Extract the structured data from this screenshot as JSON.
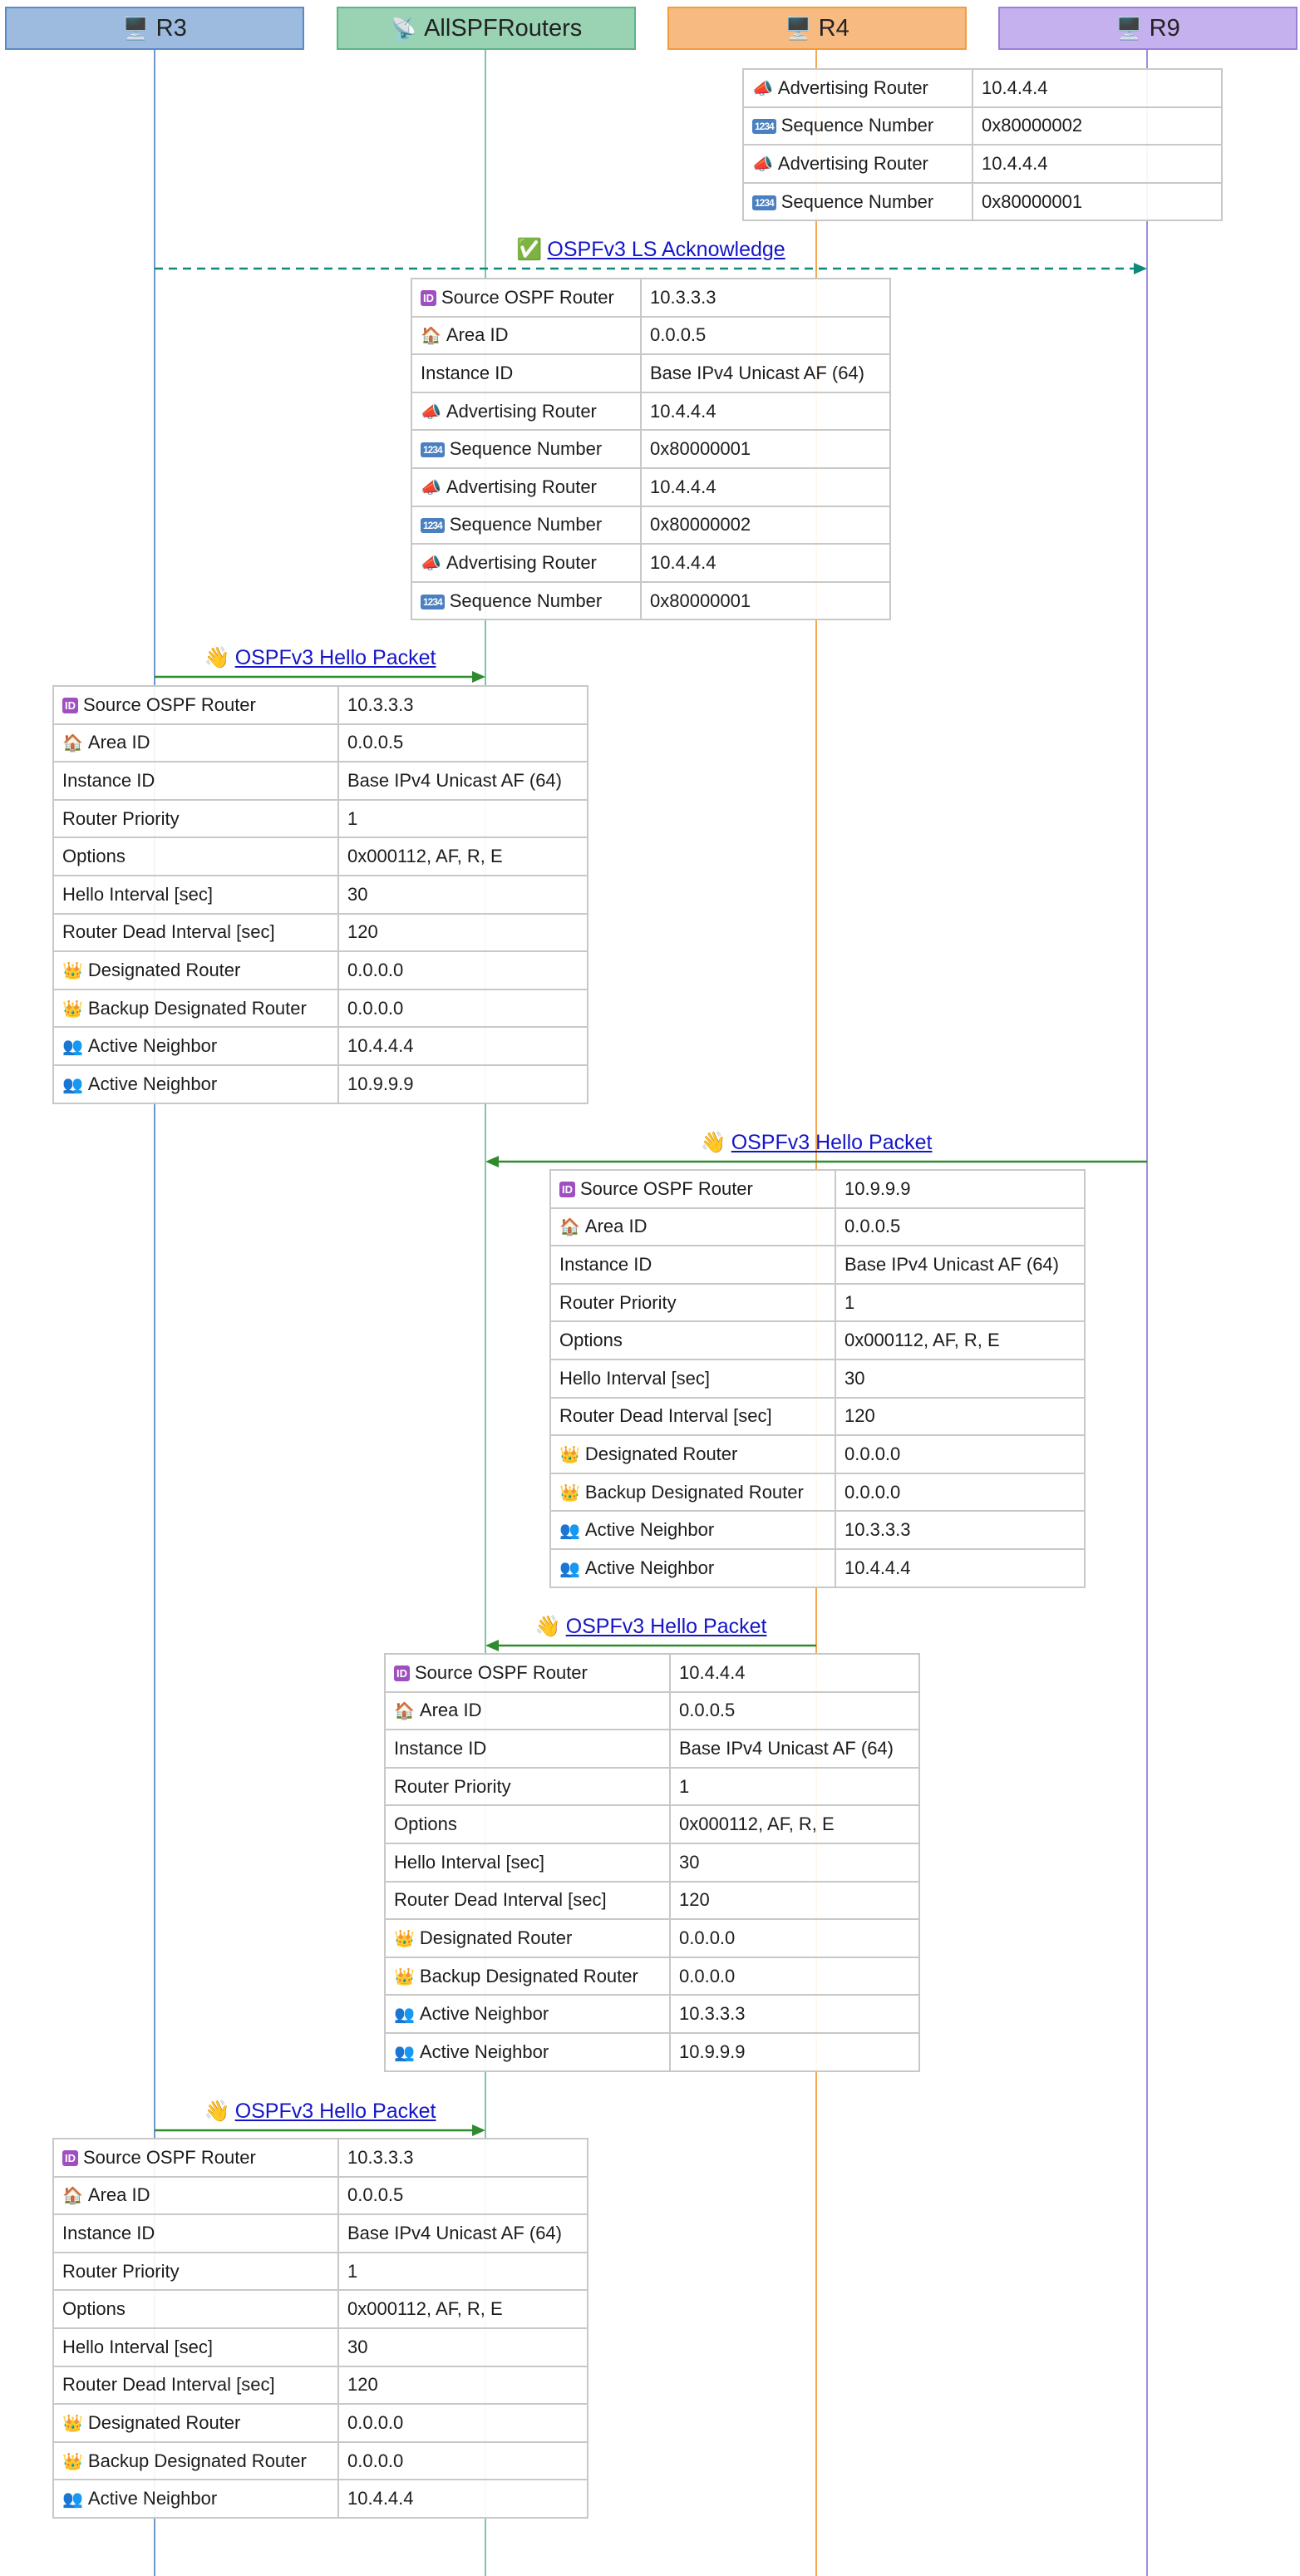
{
  "participants": [
    {
      "id": "R3",
      "label": "R3",
      "icon": "🖥️",
      "icon_name": "computer-icon",
      "fill": "#9dbbdf",
      "stroke": "#5b8ac4",
      "line": "#6d99c9"
    },
    {
      "id": "AllSPFRouters",
      "label": "AllSPFRouters",
      "icon": "📡",
      "icon_name": "satellite-antenna-icon",
      "fill": "#99d3b4",
      "stroke": "#5fb386",
      "line": "#7fc4a8"
    },
    {
      "id": "R4",
      "label": "R4",
      "icon": "🖥️",
      "icon_name": "computer-icon",
      "fill": "#f7bb82",
      "stroke": "#f59a3c",
      "line": "#f5a84f"
    },
    {
      "id": "R9",
      "label": "R9",
      "icon": "🖥️",
      "icon_name": "computer-icon",
      "fill": "#c5b1ee",
      "stroke": "#9b80d8",
      "line": "#9e8fdb"
    }
  ],
  "icons": {
    "id": {
      "glyph": "ID",
      "name": "id-badge-icon"
    },
    "home": {
      "glyph": "🏠",
      "name": "house-icon"
    },
    "megaphone": {
      "glyph": "📣",
      "name": "megaphone-icon"
    },
    "numbers": {
      "glyph": "1234",
      "name": "numbers-icon"
    },
    "crown": {
      "glyph": "👑",
      "name": "crown-icon"
    },
    "people": {
      "glyph": "👥",
      "name": "people-icon"
    },
    "wave": {
      "glyph": "👋",
      "name": "waving-hand-icon"
    },
    "check": {
      "glyph": "✅",
      "name": "check-mark-icon"
    }
  },
  "blocks": [
    {
      "kind": "table",
      "rows": [
        {
          "icon": "megaphone",
          "label": "Advertising Router",
          "value": "10.4.4.4"
        },
        {
          "icon": "numbers",
          "label": "Sequence Number",
          "value": "0x80000002"
        },
        {
          "icon": "megaphone",
          "label": "Advertising Router",
          "value": "10.4.4.4"
        },
        {
          "icon": "numbers",
          "label": "Sequence Number",
          "value": "0x80000001"
        }
      ]
    },
    {
      "kind": "message",
      "from": "R3",
      "to": "R9",
      "style": "dashed",
      "color": "#0f8a7a",
      "icon": "check",
      "label": "OSPFv3 LS Acknowledge",
      "rows": [
        {
          "icon": "id",
          "label": "Source OSPF Router",
          "value": "10.3.3.3"
        },
        {
          "icon": "home",
          "label": "Area ID",
          "value": "0.0.0.5"
        },
        {
          "icon": "",
          "label": "Instance ID",
          "value": "Base IPv4 Unicast AF (64)"
        },
        {
          "icon": "megaphone",
          "label": "Advertising Router",
          "value": "10.4.4.4"
        },
        {
          "icon": "numbers",
          "label": "Sequence Number",
          "value": "0x80000001"
        },
        {
          "icon": "megaphone",
          "label": "Advertising Router",
          "value": "10.4.4.4"
        },
        {
          "icon": "numbers",
          "label": "Sequence Number",
          "value": "0x80000002"
        },
        {
          "icon": "megaphone",
          "label": "Advertising Router",
          "value": "10.4.4.4"
        },
        {
          "icon": "numbers",
          "label": "Sequence Number",
          "value": "0x80000001"
        }
      ]
    },
    {
      "kind": "message",
      "from": "R3",
      "to": "AllSPFRouters",
      "style": "solid",
      "color": "#2e8b2e",
      "icon": "wave",
      "label": "OSPFv3 Hello Packet",
      "rows": [
        {
          "icon": "id",
          "label": "Source OSPF Router",
          "value": "10.3.3.3"
        },
        {
          "icon": "home",
          "label": "Area ID",
          "value": "0.0.0.5"
        },
        {
          "icon": "",
          "label": "Instance ID",
          "value": "Base IPv4 Unicast AF (64)"
        },
        {
          "icon": "",
          "label": "Router Priority",
          "value": "1"
        },
        {
          "icon": "",
          "label": "Options",
          "value": "0x000112, AF, R, E"
        },
        {
          "icon": "",
          "label": "Hello Interval [sec]",
          "value": "30"
        },
        {
          "icon": "",
          "label": "Router Dead Interval [sec]",
          "value": "120"
        },
        {
          "icon": "crown",
          "label": "Designated Router",
          "value": "0.0.0.0"
        },
        {
          "icon": "crown",
          "label": "Backup Designated Router",
          "value": "0.0.0.0"
        },
        {
          "icon": "people",
          "label": "Active Neighbor",
          "value": "10.4.4.4"
        },
        {
          "icon": "people",
          "label": "Active Neighbor",
          "value": "10.9.9.9"
        }
      ]
    },
    {
      "kind": "message",
      "from": "R9",
      "to": "AllSPFRouters",
      "style": "solid",
      "color": "#2e8b2e",
      "icon": "wave",
      "label": "OSPFv3 Hello Packet",
      "rows": [
        {
          "icon": "id",
          "label": "Source OSPF Router",
          "value": "10.9.9.9"
        },
        {
          "icon": "home",
          "label": "Area ID",
          "value": "0.0.0.5"
        },
        {
          "icon": "",
          "label": "Instance ID",
          "value": "Base IPv4 Unicast AF (64)"
        },
        {
          "icon": "",
          "label": "Router Priority",
          "value": "1"
        },
        {
          "icon": "",
          "label": "Options",
          "value": "0x000112, AF, R, E"
        },
        {
          "icon": "",
          "label": "Hello Interval [sec]",
          "value": "30"
        },
        {
          "icon": "",
          "label": "Router Dead Interval [sec]",
          "value": "120"
        },
        {
          "icon": "crown",
          "label": "Designated Router",
          "value": "0.0.0.0"
        },
        {
          "icon": "crown",
          "label": "Backup Designated Router",
          "value": "0.0.0.0"
        },
        {
          "icon": "people",
          "label": "Active Neighbor",
          "value": "10.3.3.3"
        },
        {
          "icon": "people",
          "label": "Active Neighbor",
          "value": "10.4.4.4"
        }
      ]
    },
    {
      "kind": "message",
      "from": "R4",
      "to": "AllSPFRouters",
      "style": "solid",
      "color": "#2e8b2e",
      "icon": "wave",
      "label": "OSPFv3 Hello Packet",
      "rows": [
        {
          "icon": "id",
          "label": "Source OSPF Router",
          "value": "10.4.4.4"
        },
        {
          "icon": "home",
          "label": "Area ID",
          "value": "0.0.0.5"
        },
        {
          "icon": "",
          "label": "Instance ID",
          "value": "Base IPv4 Unicast AF (64)"
        },
        {
          "icon": "",
          "label": "Router Priority",
          "value": "1"
        },
        {
          "icon": "",
          "label": "Options",
          "value": "0x000112, AF, R, E"
        },
        {
          "icon": "",
          "label": "Hello Interval [sec]",
          "value": "30"
        },
        {
          "icon": "",
          "label": "Router Dead Interval [sec]",
          "value": "120"
        },
        {
          "icon": "crown",
          "label": "Designated Router",
          "value": "0.0.0.0"
        },
        {
          "icon": "crown",
          "label": "Backup Designated Router",
          "value": "0.0.0.0"
        },
        {
          "icon": "people",
          "label": "Active Neighbor",
          "value": "10.3.3.3"
        },
        {
          "icon": "people",
          "label": "Active Neighbor",
          "value": "10.9.9.9"
        }
      ]
    },
    {
      "kind": "message",
      "from": "R3",
      "to": "AllSPFRouters",
      "style": "solid",
      "color": "#2e8b2e",
      "icon": "wave",
      "label": "OSPFv3 Hello Packet",
      "rows": [
        {
          "icon": "id",
          "label": "Source OSPF Router",
          "value": "10.3.3.3"
        },
        {
          "icon": "home",
          "label": "Area ID",
          "value": "0.0.0.5"
        },
        {
          "icon": "",
          "label": "Instance ID",
          "value": "Base IPv4 Unicast AF (64)"
        },
        {
          "icon": "",
          "label": "Router Priority",
          "value": "1"
        },
        {
          "icon": "",
          "label": "Options",
          "value": "0x000112, AF, R, E"
        },
        {
          "icon": "",
          "label": "Hello Interval [sec]",
          "value": "30"
        },
        {
          "icon": "",
          "label": "Router Dead Interval [sec]",
          "value": "120"
        },
        {
          "icon": "crown",
          "label": "Designated Router",
          "value": "0.0.0.0"
        },
        {
          "icon": "crown",
          "label": "Backup Designated Router",
          "value": "0.0.0.0"
        },
        {
          "icon": "people",
          "label": "Active Neighbor",
          "value": "10.4.4.4"
        }
      ]
    }
  ]
}
